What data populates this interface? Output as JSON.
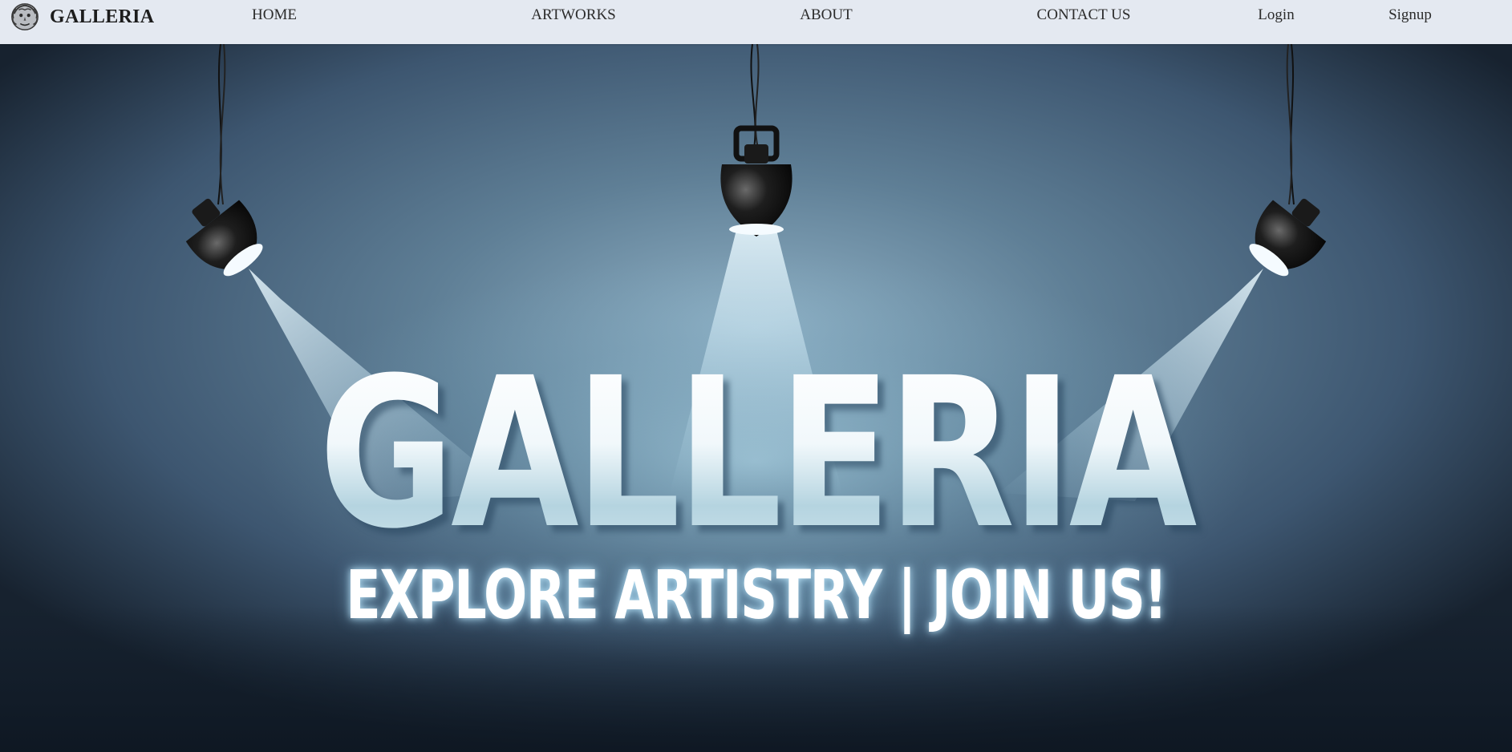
{
  "brand": {
    "name": "GALLERIA",
    "logo_icon": "medusa-head-icon"
  },
  "nav": {
    "home": "HOME",
    "artworks": "ARTWORKS",
    "about": "ABOUT",
    "contact": "CONTACT US",
    "login": "Login",
    "signup": "Signup"
  },
  "hero": {
    "title": "GALLERIA",
    "subtitle": "EXPLORE ARTISTRY | JOIN US!"
  },
  "colors": {
    "navbar_bg": "#e4e9f1",
    "hero_bg": "#4e6a80",
    "hero_dark": "#132030",
    "text_glow": "#bfe6fa"
  }
}
